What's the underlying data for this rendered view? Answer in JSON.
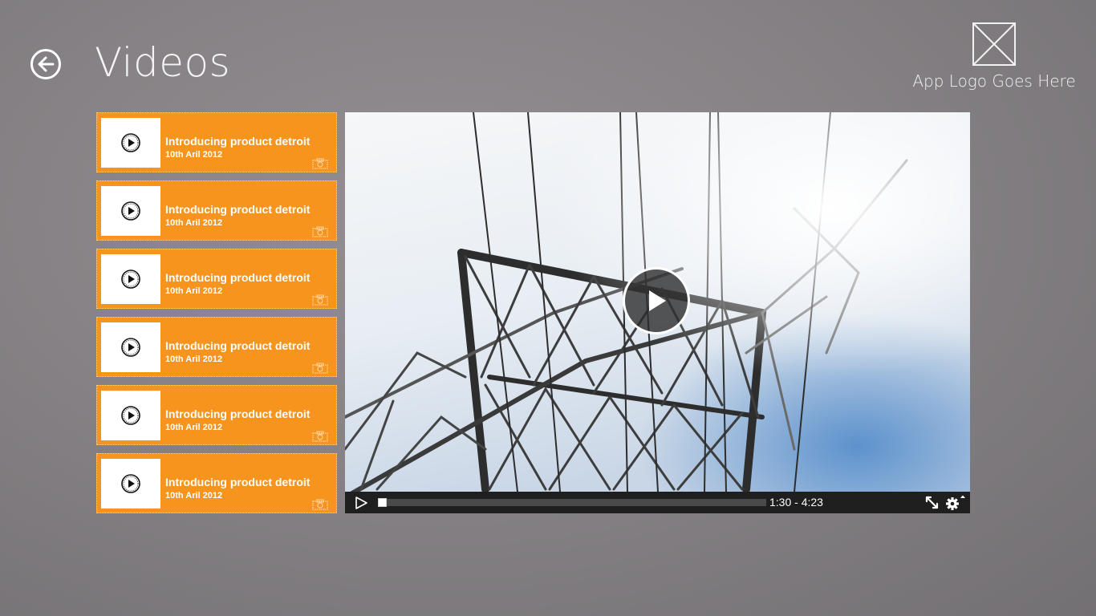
{
  "page": {
    "title": "Videos"
  },
  "logo": {
    "text": "App Logo Goes Here"
  },
  "videos": [
    {
      "title": "Introducing product detroit",
      "date": "10th Aril 2012"
    },
    {
      "title": "Introducing product detroit",
      "date": "10th Aril 2012"
    },
    {
      "title": "Introducing product detroit",
      "date": "10th Aril 2012"
    },
    {
      "title": "Introducing product detroit",
      "date": "10th Aril 2012"
    },
    {
      "title": "Introducing product detroit",
      "date": "10th Aril 2012"
    },
    {
      "title": "Introducing product detroit",
      "date": "10th Aril 2012"
    }
  ],
  "player": {
    "time_display": "1:30 - 4:23",
    "progress": 0.0,
    "icons": [
      "play-icon",
      "fullscreen-icon",
      "settings-icon"
    ]
  },
  "colors": {
    "accent": "#f7941d",
    "control_bar": "#1f1f1f",
    "background": "#868285"
  }
}
